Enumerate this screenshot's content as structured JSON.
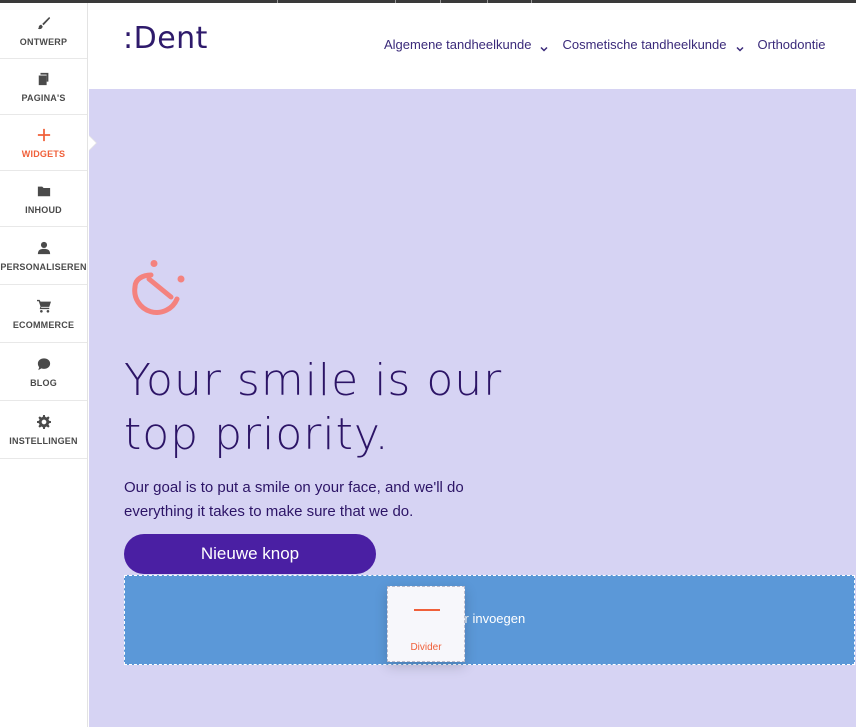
{
  "sidebar": {
    "items": [
      {
        "label": "ONTWERP",
        "icon": "brush-icon"
      },
      {
        "label": "PAGINA'S",
        "icon": "pages-icon"
      },
      {
        "label": "WIDGETS",
        "icon": "plus-icon",
        "active": true
      },
      {
        "label": "INHOUD",
        "icon": "folder-icon"
      },
      {
        "label": "PERSONALISEREN",
        "icon": "person-icon"
      },
      {
        "label": "ECOMMERCE",
        "icon": "cart-icon"
      },
      {
        "label": "BLOG",
        "icon": "chat-icon"
      },
      {
        "label": "INSTELLINGEN",
        "icon": "gear-icon"
      }
    ]
  },
  "site": {
    "logo": ":Dent",
    "nav": [
      {
        "label": "Algemene tandheelkunde"
      },
      {
        "label": "Cosmetische tandheelkunde"
      },
      {
        "label": "Orthodontie"
      }
    ]
  },
  "hero": {
    "headline": "Your smile is our top priority.",
    "subtext": "Our goal is to put a smile on your face, and we'll do everything it takes to make sure that we do.",
    "button_label": "Nieuwe knop",
    "drop_hint": "Hier invoegen",
    "drag_widget_label": "Divider"
  },
  "colors": {
    "accent": "#f0603a",
    "hero_bg": "#d6d3f3",
    "brand_text": "#2c1466",
    "button_bg": "#4a1fa3",
    "dropzone_bg": "#5b98d8"
  }
}
